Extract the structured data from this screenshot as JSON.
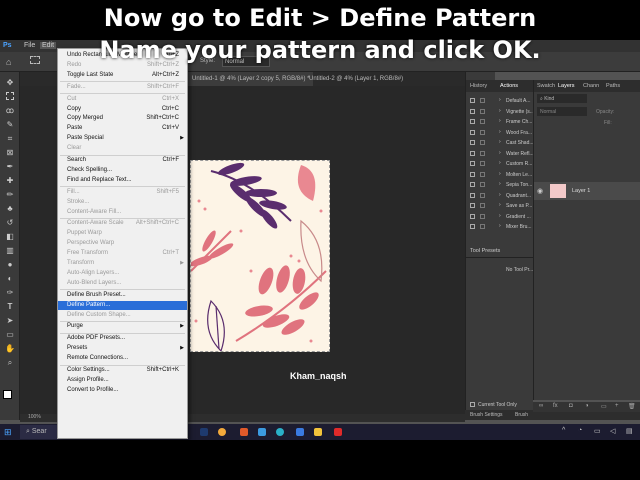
{
  "caption": {
    "line1": "Now go to Edit > Define Pattern",
    "line2": "Name your pattern and click OK."
  },
  "menubar": {
    "file": "File",
    "edit": "Edit"
  },
  "options_bar": {
    "date": "15.08.2026",
    "style_label": "Style:",
    "style_value": "Normal"
  },
  "doc_tabs": [
    {
      "label": "Untitled-1 @ 4% (Layer 2 copy 5, RGB/8#) *"
    },
    {
      "label": "Untitled-2 @ 4% (Layer 1, RGB/8#)"
    }
  ],
  "zoom": "100%",
  "edit_menu": {
    "items": [
      {
        "label": "Undo Rectangular Marquee",
        "shortcut": "Ctrl+Z",
        "disabled": false
      },
      {
        "label": "Redo",
        "shortcut": "Shift+Ctrl+Z",
        "disabled": true
      },
      {
        "label": "Toggle Last State",
        "shortcut": "Alt+Ctrl+Z",
        "disabled": false
      },
      {
        "label": "Fade...",
        "shortcut": "Shift+Ctrl+F",
        "disabled": true
      },
      {
        "label": "Cut",
        "shortcut": "Ctrl+X",
        "disabled": true
      },
      {
        "label": "Copy",
        "shortcut": "Ctrl+C",
        "disabled": false
      },
      {
        "label": "Copy Merged",
        "shortcut": "Shift+Ctrl+C",
        "disabled": false
      },
      {
        "label": "Paste",
        "shortcut": "Ctrl+V",
        "disabled": false
      },
      {
        "label": "Paste Special",
        "shortcut": "",
        "disabled": false,
        "submenu": true
      },
      {
        "label": "Clear",
        "shortcut": "",
        "disabled": true
      },
      {
        "label": "Search",
        "shortcut": "Ctrl+F",
        "disabled": false
      },
      {
        "label": "Check Spelling...",
        "shortcut": "",
        "disabled": false
      },
      {
        "label": "Find and Replace Text...",
        "shortcut": "",
        "disabled": false
      },
      {
        "label": "Fill...",
        "shortcut": "Shift+F5",
        "disabled": true
      },
      {
        "label": "Stroke...",
        "shortcut": "",
        "disabled": true
      },
      {
        "label": "Content-Aware Fill...",
        "shortcut": "",
        "disabled": true
      },
      {
        "label": "Content-Aware Scale",
        "shortcut": "Alt+Shift+Ctrl+C",
        "disabled": true
      },
      {
        "label": "Puppet Warp",
        "shortcut": "",
        "disabled": true
      },
      {
        "label": "Perspective Warp",
        "shortcut": "",
        "disabled": true
      },
      {
        "label": "Free Transform",
        "shortcut": "Ctrl+T",
        "disabled": true
      },
      {
        "label": "Transform",
        "shortcut": "",
        "disabled": true,
        "submenu": true
      },
      {
        "label": "Auto-Align Layers...",
        "shortcut": "",
        "disabled": true
      },
      {
        "label": "Auto-Blend Layers...",
        "shortcut": "",
        "disabled": true
      },
      {
        "label": "Define Brush Preset...",
        "shortcut": "",
        "disabled": false
      },
      {
        "label": "Define Pattern...",
        "shortcut": "",
        "disabled": false,
        "selected": true
      },
      {
        "label": "Define Custom Shape...",
        "shortcut": "",
        "disabled": true
      },
      {
        "label": "Purge",
        "shortcut": "",
        "disabled": false,
        "submenu": true
      },
      {
        "label": "Adobe PDF Presets...",
        "shortcut": "",
        "disabled": false
      },
      {
        "label": "Presets",
        "shortcut": "",
        "disabled": false,
        "submenu": true
      },
      {
        "label": "Remote Connections...",
        "shortcut": "",
        "disabled": false
      },
      {
        "label": "Color Settings...",
        "shortcut": "Shift+Ctrl+K",
        "disabled": false
      },
      {
        "label": "Assign Profile...",
        "shortcut": "",
        "disabled": false
      },
      {
        "label": "Convert to Profile...",
        "shortcut": "",
        "disabled": false
      }
    ]
  },
  "actions_panel": {
    "tabs": [
      "History",
      "Actions"
    ],
    "rows": [
      "Default A...",
      "Vignette (s...",
      "Frame Ch...",
      "Wood Fra...",
      "Cast Shad...",
      "Water Refl...",
      "Custom R...",
      "Molten Le...",
      "Sepia Ton...",
      "Quadrant...",
      "Save as P...",
      "Gradient ...",
      "Mixer Bru..."
    ]
  },
  "layers_panel": {
    "tabs": [
      "Swatch",
      "Layers",
      "Chann",
      "Paths"
    ],
    "kind": "Kind",
    "mode": "Normal",
    "opacity_label": "Opacity:",
    "fill_label": "Fill:",
    "layer_name": "Layer 1"
  },
  "tool_presets": {
    "title": "Tool Presets",
    "empty": "No Tool Pr...",
    "current_only": "Current Tool Only"
  },
  "brush_tabs": [
    "Brush Settings",
    "Brush"
  ],
  "taskbar": {
    "search": "Sear"
  },
  "watermark": "Kham_naqsh",
  "colors": {
    "menu_highlight": "#2a6ed8",
    "pattern_purple": "#5a2d6e",
    "pattern_pink": "#e0737e"
  }
}
